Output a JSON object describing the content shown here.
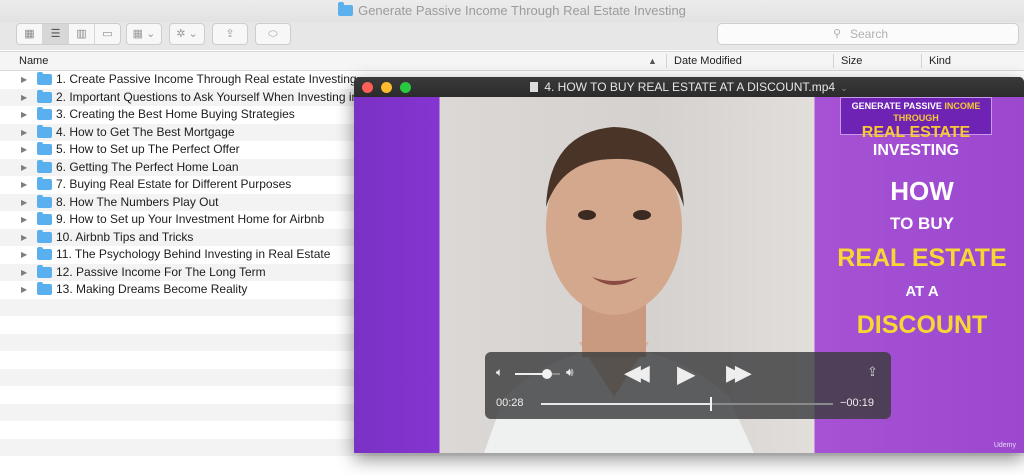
{
  "finder": {
    "title": "Generate Passive Income Through Real Estate Investing",
    "search_placeholder": "Search",
    "columns": {
      "name": "Name",
      "date_modified": "Date Modified",
      "size": "Size",
      "kind": "Kind"
    },
    "items": [
      {
        "label": "1. Create Passive Income Through Real estate Investing"
      },
      {
        "label": "2. Important Questions to Ask Yourself When Investing in"
      },
      {
        "label": "3. Creating the Best Home Buying Strategies"
      },
      {
        "label": "4. How to Get The Best Mortgage"
      },
      {
        "label": "5. How to Set up The Perfect Offer"
      },
      {
        "label": "6. Getting The Perfect Home Loan"
      },
      {
        "label": "7. Buying Real Estate for Different Purposes"
      },
      {
        "label": "8. How The Numbers Play Out"
      },
      {
        "label": "9. How to Set up Your Investment Home for Airbnb"
      },
      {
        "label": "10. Airbnb Tips and Tricks"
      },
      {
        "label": "11. The Psychology Behind Investing in Real Estate"
      },
      {
        "label": "12. Passive Income For The Long Term"
      },
      {
        "label": "13. Making Dreams Become Reality"
      }
    ],
    "folder_color": "#5ab0ef"
  },
  "player": {
    "title": "4. HOW TO BUY REAL ESTATE AT A DISCOUNT.mp4",
    "elapsed": "00:28",
    "remaining": "−00:19",
    "progress": 0.58,
    "volume": 0.7,
    "brand_line1_a": "GENERATE PASSIVE",
    "brand_line1_b": "INCOME THROUGH",
    "brand_line2_a": "REAL ESTATE",
    "brand_line2_b": "INVESTING",
    "headline": [
      "HOW",
      "TO BUY",
      "REAL ESTATE",
      "AT A",
      "DISCOUNT"
    ],
    "watermark": "Udemy",
    "accent_purple": "#8534d0",
    "accent_yellow": "#f7d733"
  }
}
